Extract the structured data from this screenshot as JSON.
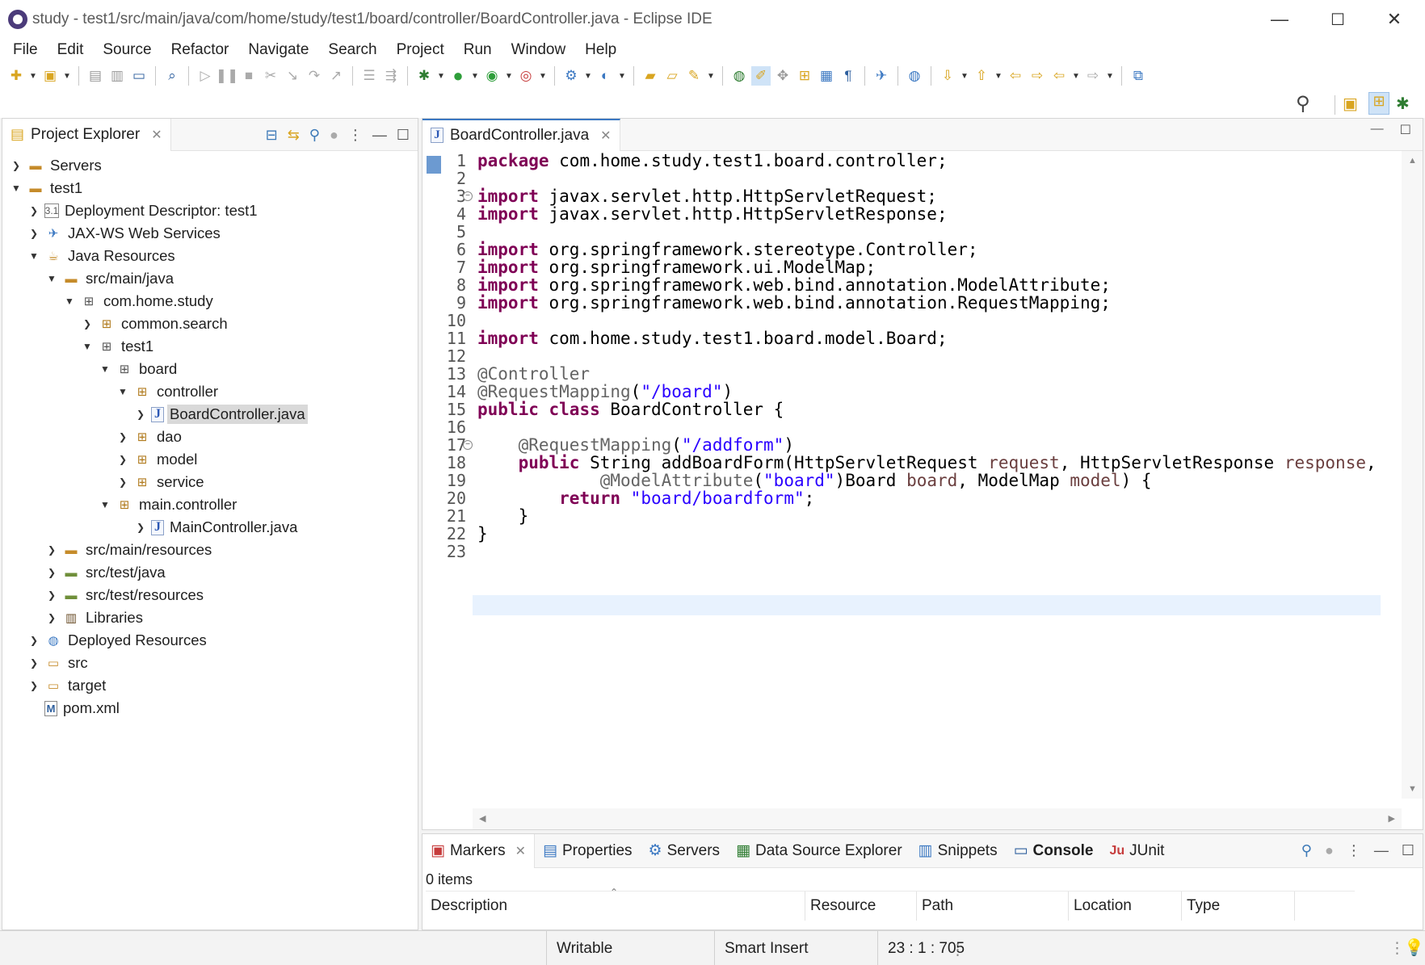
{
  "window": {
    "title": "study - test1/src/main/java/com/home/study/test1/board/controller/BoardController.java - Eclipse IDE",
    "minimize": "—",
    "maximize": "☐",
    "close": "✕"
  },
  "menu": [
    "File",
    "Edit",
    "Source",
    "Refactor",
    "Navigate",
    "Search",
    "Project",
    "Run",
    "Window",
    "Help"
  ],
  "explorer": {
    "title": "Project Explorer",
    "tree": [
      {
        "label": "Servers",
        "icon": "folder-icon",
        "expanded": false
      },
      {
        "label": "test1",
        "icon": "project-icon",
        "expanded": true
      },
      {
        "label": "Deployment Descriptor: test1",
        "icon": "deployment-descriptor-icon",
        "expanded": false
      },
      {
        "label": "JAX-WS Web Services",
        "icon": "web-services-icon",
        "expanded": false
      },
      {
        "label": "Java Resources",
        "icon": "java-resources-icon",
        "expanded": true
      },
      {
        "label": "src/main/java",
        "icon": "source-folder-icon",
        "expanded": true
      },
      {
        "label": "com.home.study",
        "icon": "package-icon",
        "expanded": true
      },
      {
        "label": "common.search",
        "icon": "package-icon",
        "expanded": false
      },
      {
        "label": "test1",
        "icon": "package-icon",
        "expanded": true
      },
      {
        "label": "board",
        "icon": "package-icon",
        "expanded": true
      },
      {
        "label": "controller",
        "icon": "package-icon",
        "expanded": true
      },
      {
        "label": "BoardController.java",
        "icon": "java-file-icon",
        "expanded": false,
        "selected": true
      },
      {
        "label": "dao",
        "icon": "package-icon",
        "expanded": false
      },
      {
        "label": "model",
        "icon": "package-icon",
        "expanded": false
      },
      {
        "label": "service",
        "icon": "package-icon",
        "expanded": false
      },
      {
        "label": "main.controller",
        "icon": "package-icon",
        "expanded": true
      },
      {
        "label": "MainController.java",
        "icon": "java-file-icon",
        "expanded": false
      },
      {
        "label": "src/main/resources",
        "icon": "source-folder-icon",
        "expanded": false
      },
      {
        "label": "src/test/java",
        "icon": "source-folder-icon",
        "expanded": false
      },
      {
        "label": "src/test/resources",
        "icon": "source-folder-icon",
        "expanded": false
      },
      {
        "label": "Libraries",
        "icon": "libraries-icon",
        "expanded": false
      },
      {
        "label": "Deployed Resources",
        "icon": "deployed-resources-icon",
        "expanded": false
      },
      {
        "label": "src",
        "icon": "folder-icon",
        "expanded": false
      },
      {
        "label": "target",
        "icon": "folder-icon",
        "expanded": false
      },
      {
        "label": "pom.xml",
        "icon": "maven-file-icon",
        "expanded": false
      }
    ]
  },
  "editor": {
    "tab": "BoardController.java",
    "line_numbers": [
      "1",
      "2",
      "3",
      "4",
      "5",
      "6",
      "7",
      "8",
      "9",
      "10",
      "11",
      "12",
      "13",
      "14",
      "15",
      "16",
      "17",
      "18",
      "19",
      "20",
      "21",
      "22",
      "23"
    ],
    "lines": [
      "package com.home.study.test1.board.controller;",
      "",
      "import javax.servlet.http.HttpServletRequest;",
      "import javax.servlet.http.HttpServletResponse;",
      "",
      "import org.springframework.stereotype.Controller;",
      "import org.springframework.ui.ModelMap;",
      "import org.springframework.web.bind.annotation.ModelAttribute;",
      "import org.springframework.web.bind.annotation.RequestMapping;",
      "",
      "import com.home.study.test1.board.model.Board;",
      "",
      "@Controller",
      "@RequestMapping(\"/board\")",
      "public class BoardController {",
      "",
      "    @RequestMapping(\"/addform\")",
      "    public String addBoardForm(HttpServletRequest request, HttpServletResponse response,",
      "            @ModelAttribute(\"board\")Board board, ModelMap model) {",
      "        return \"board/boardform\";",
      "    }",
      "}",
      ""
    ],
    "current_line": "23"
  },
  "bottom": {
    "tabs": [
      "Markers",
      "Properties",
      "Servers",
      "Data Source Explorer",
      "Snippets",
      "Console",
      "JUnit"
    ],
    "active_tab": "Console",
    "items_count": "0 items",
    "columns": [
      "Description",
      "Resource",
      "Path",
      "Location",
      "Type"
    ]
  },
  "status": {
    "writable": "Writable",
    "insert_mode": "Smart Insert",
    "position": "23 : 1 : 705"
  }
}
